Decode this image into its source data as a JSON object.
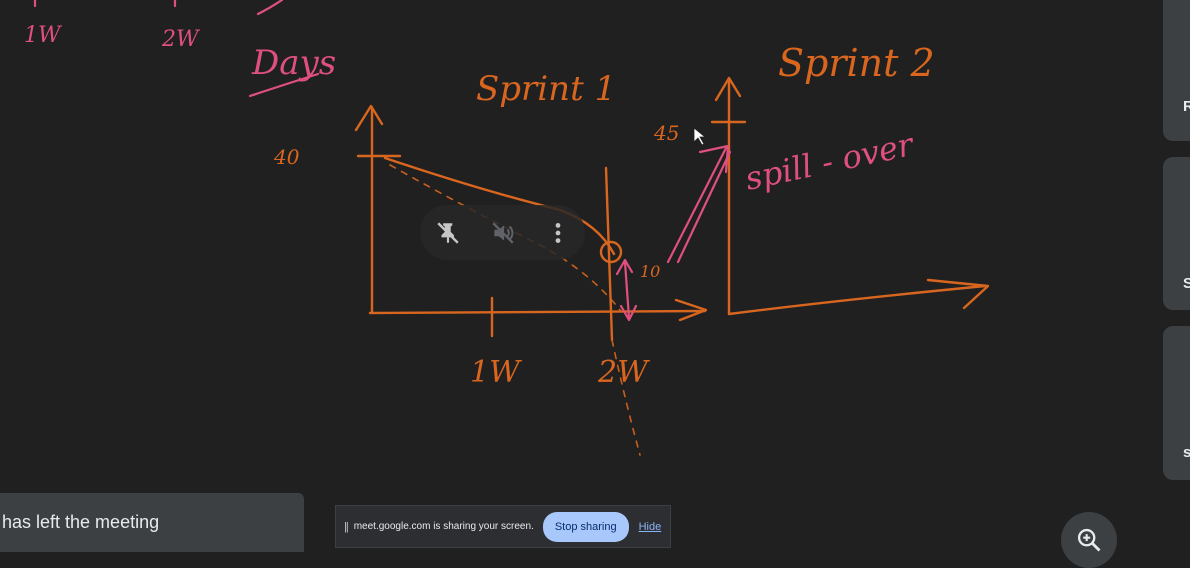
{
  "whiteboard": {
    "labels_top_left": [
      "1W",
      "2W"
    ],
    "days_label": "Days",
    "sprint1_title": "Sprint 1",
    "sprint2_title": "Sprint 2",
    "value_40": "40",
    "value_45": "45",
    "value_10": "10",
    "spill_over": "spill - over",
    "tick_1w": "1W",
    "tick_2w": "2W"
  },
  "participants": {
    "tiles": [
      {
        "initial": "R"
      },
      {
        "initial": "S"
      },
      {
        "initial": "s"
      }
    ]
  },
  "hover_controls": {
    "pin_icon": "unpin-icon",
    "mute_icon": "volume-off-icon",
    "more_icon": "more-vert-icon"
  },
  "toast": {
    "text": "has left the meeting"
  },
  "share_bar": {
    "text": "meet.google.com is sharing your screen.",
    "stop_label": "Stop sharing",
    "hide_label": "Hide"
  },
  "zoom": {
    "icon": "zoom-in-icon"
  },
  "colors": {
    "background": "#202020",
    "orange_ink": "#d9661f",
    "pink_ink": "#e0507e",
    "stop_button": "#a8c7fa"
  }
}
